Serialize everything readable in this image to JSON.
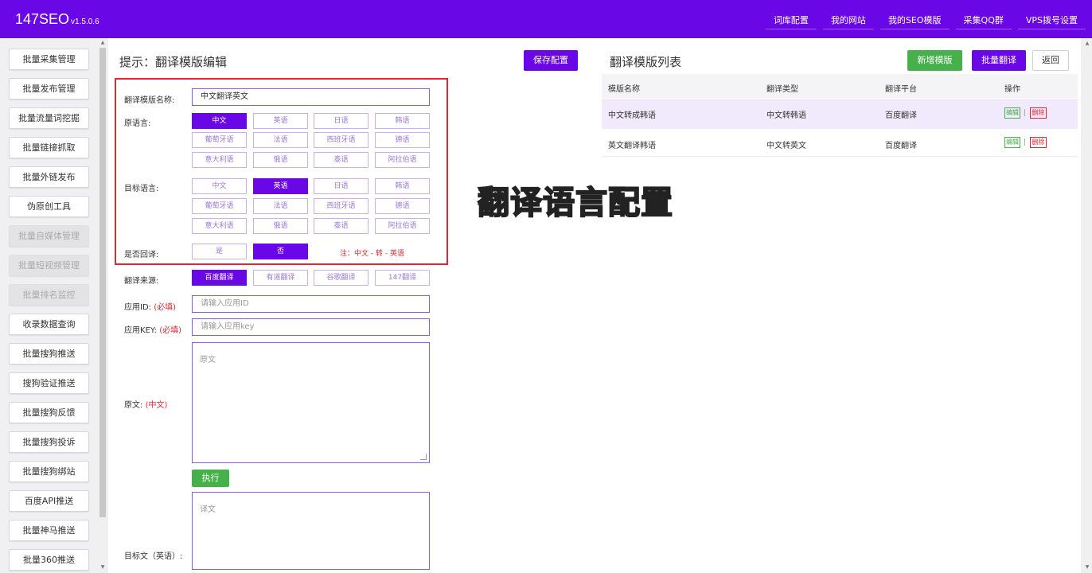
{
  "app": {
    "brand": "147SEO",
    "version": "v1.5.0.6"
  },
  "topnav": [
    "词库配置",
    "我的网站",
    "我的SEO模版",
    "采集QQ群",
    "VPS拨号设置"
  ],
  "sidebar": [
    {
      "label": "批量采集管理",
      "disabled": false
    },
    {
      "label": "批量发布管理",
      "disabled": false
    },
    {
      "label": "批量流量词挖掘",
      "disabled": false
    },
    {
      "label": "批量链接抓取",
      "disabled": false
    },
    {
      "label": "批量外链发布",
      "disabled": false
    },
    {
      "label": "伪原创工具",
      "disabled": false
    },
    {
      "label": "批量自媒体管理",
      "disabled": true
    },
    {
      "label": "批量短视频管理",
      "disabled": true
    },
    {
      "label": "批量排名监控",
      "disabled": true
    },
    {
      "label": "收录数据查询",
      "disabled": false
    },
    {
      "label": "批量搜狗推送",
      "disabled": false
    },
    {
      "label": "搜狗验证推送",
      "disabled": false
    },
    {
      "label": "批量搜狗反馈",
      "disabled": false
    },
    {
      "label": "批量搜狗投诉",
      "disabled": false
    },
    {
      "label": "批量搜狗绑站",
      "disabled": false
    },
    {
      "label": "百度API推送",
      "disabled": false
    },
    {
      "label": "批量神马推送",
      "disabled": false
    },
    {
      "label": "批量360推送",
      "disabled": false
    }
  ],
  "editor": {
    "title": "提示：翻译模版编辑",
    "save_label": "保存配置",
    "name_label": "翻译模版名称:",
    "name_value": "中文翻译英文",
    "source_label": "原语言:",
    "target_label": "目标语言:",
    "languages": [
      "中文",
      "英语",
      "日语",
      "韩语",
      "葡萄牙语",
      "法语",
      "西班牙语",
      "德语",
      "意大利语",
      "俄语",
      "泰语",
      "阿拉伯语"
    ],
    "source_selected": "中文",
    "target_selected": "英语",
    "backtranslate_label": "是否回译:",
    "backtranslate_options": [
      "是",
      "否"
    ],
    "backtranslate_selected": "否",
    "backtranslate_note": "注：中文 - 转 - 英语",
    "engine_label": "翻译来源:",
    "engines": [
      "百度翻译",
      "有道翻译",
      "谷歌翻译",
      "147翻译"
    ],
    "engine_selected": "百度翻译",
    "appid_label": "应用ID:",
    "appid_req": "(必填)",
    "appid_placeholder": "请输入应用ID",
    "appkey_label": "应用KEY:",
    "appkey_req": "(必填)",
    "appkey_placeholder": "请输入应用key",
    "original_label": "原文:",
    "original_lang": "(中文)",
    "original_placeholder": "原文",
    "run_label": "执行",
    "target_text_label": "目标文（英语）:",
    "target_text_placeholder": "译文"
  },
  "overlay_caption": "翻译语言配置",
  "list": {
    "title": "翻译模版列表",
    "add_label": "新增模版",
    "batch_label": "批量翻译",
    "back_label": "返回",
    "headers": [
      "模版名称",
      "翻译类型",
      "翻译平台",
      "操作"
    ],
    "rows": [
      {
        "name": "中文转成韩语",
        "type": "中文转韩语",
        "platform": "百度翻译"
      },
      {
        "name": "英文翻译韩语",
        "type": "中文转英文",
        "platform": "百度翻译"
      }
    ],
    "edit_label": "编辑",
    "delete_label": "删除",
    "sep": "|"
  },
  "colors": {
    "accent": "#6a07e6",
    "green": "#46b04b",
    "red": "#e5262f"
  }
}
